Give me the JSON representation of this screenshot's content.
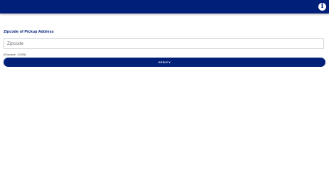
{
  "header": {
    "info_icon": "info-icon",
    "info_glyph": "i",
    "color": "#001f78"
  },
  "form": {
    "label": "Zipcode of Pickup Address",
    "input_value": "",
    "input_placeholder": "Zipcode",
    "helper": "(Example: 12345)",
    "button_label": "VERIFY",
    "accent_color": "#001f78"
  }
}
